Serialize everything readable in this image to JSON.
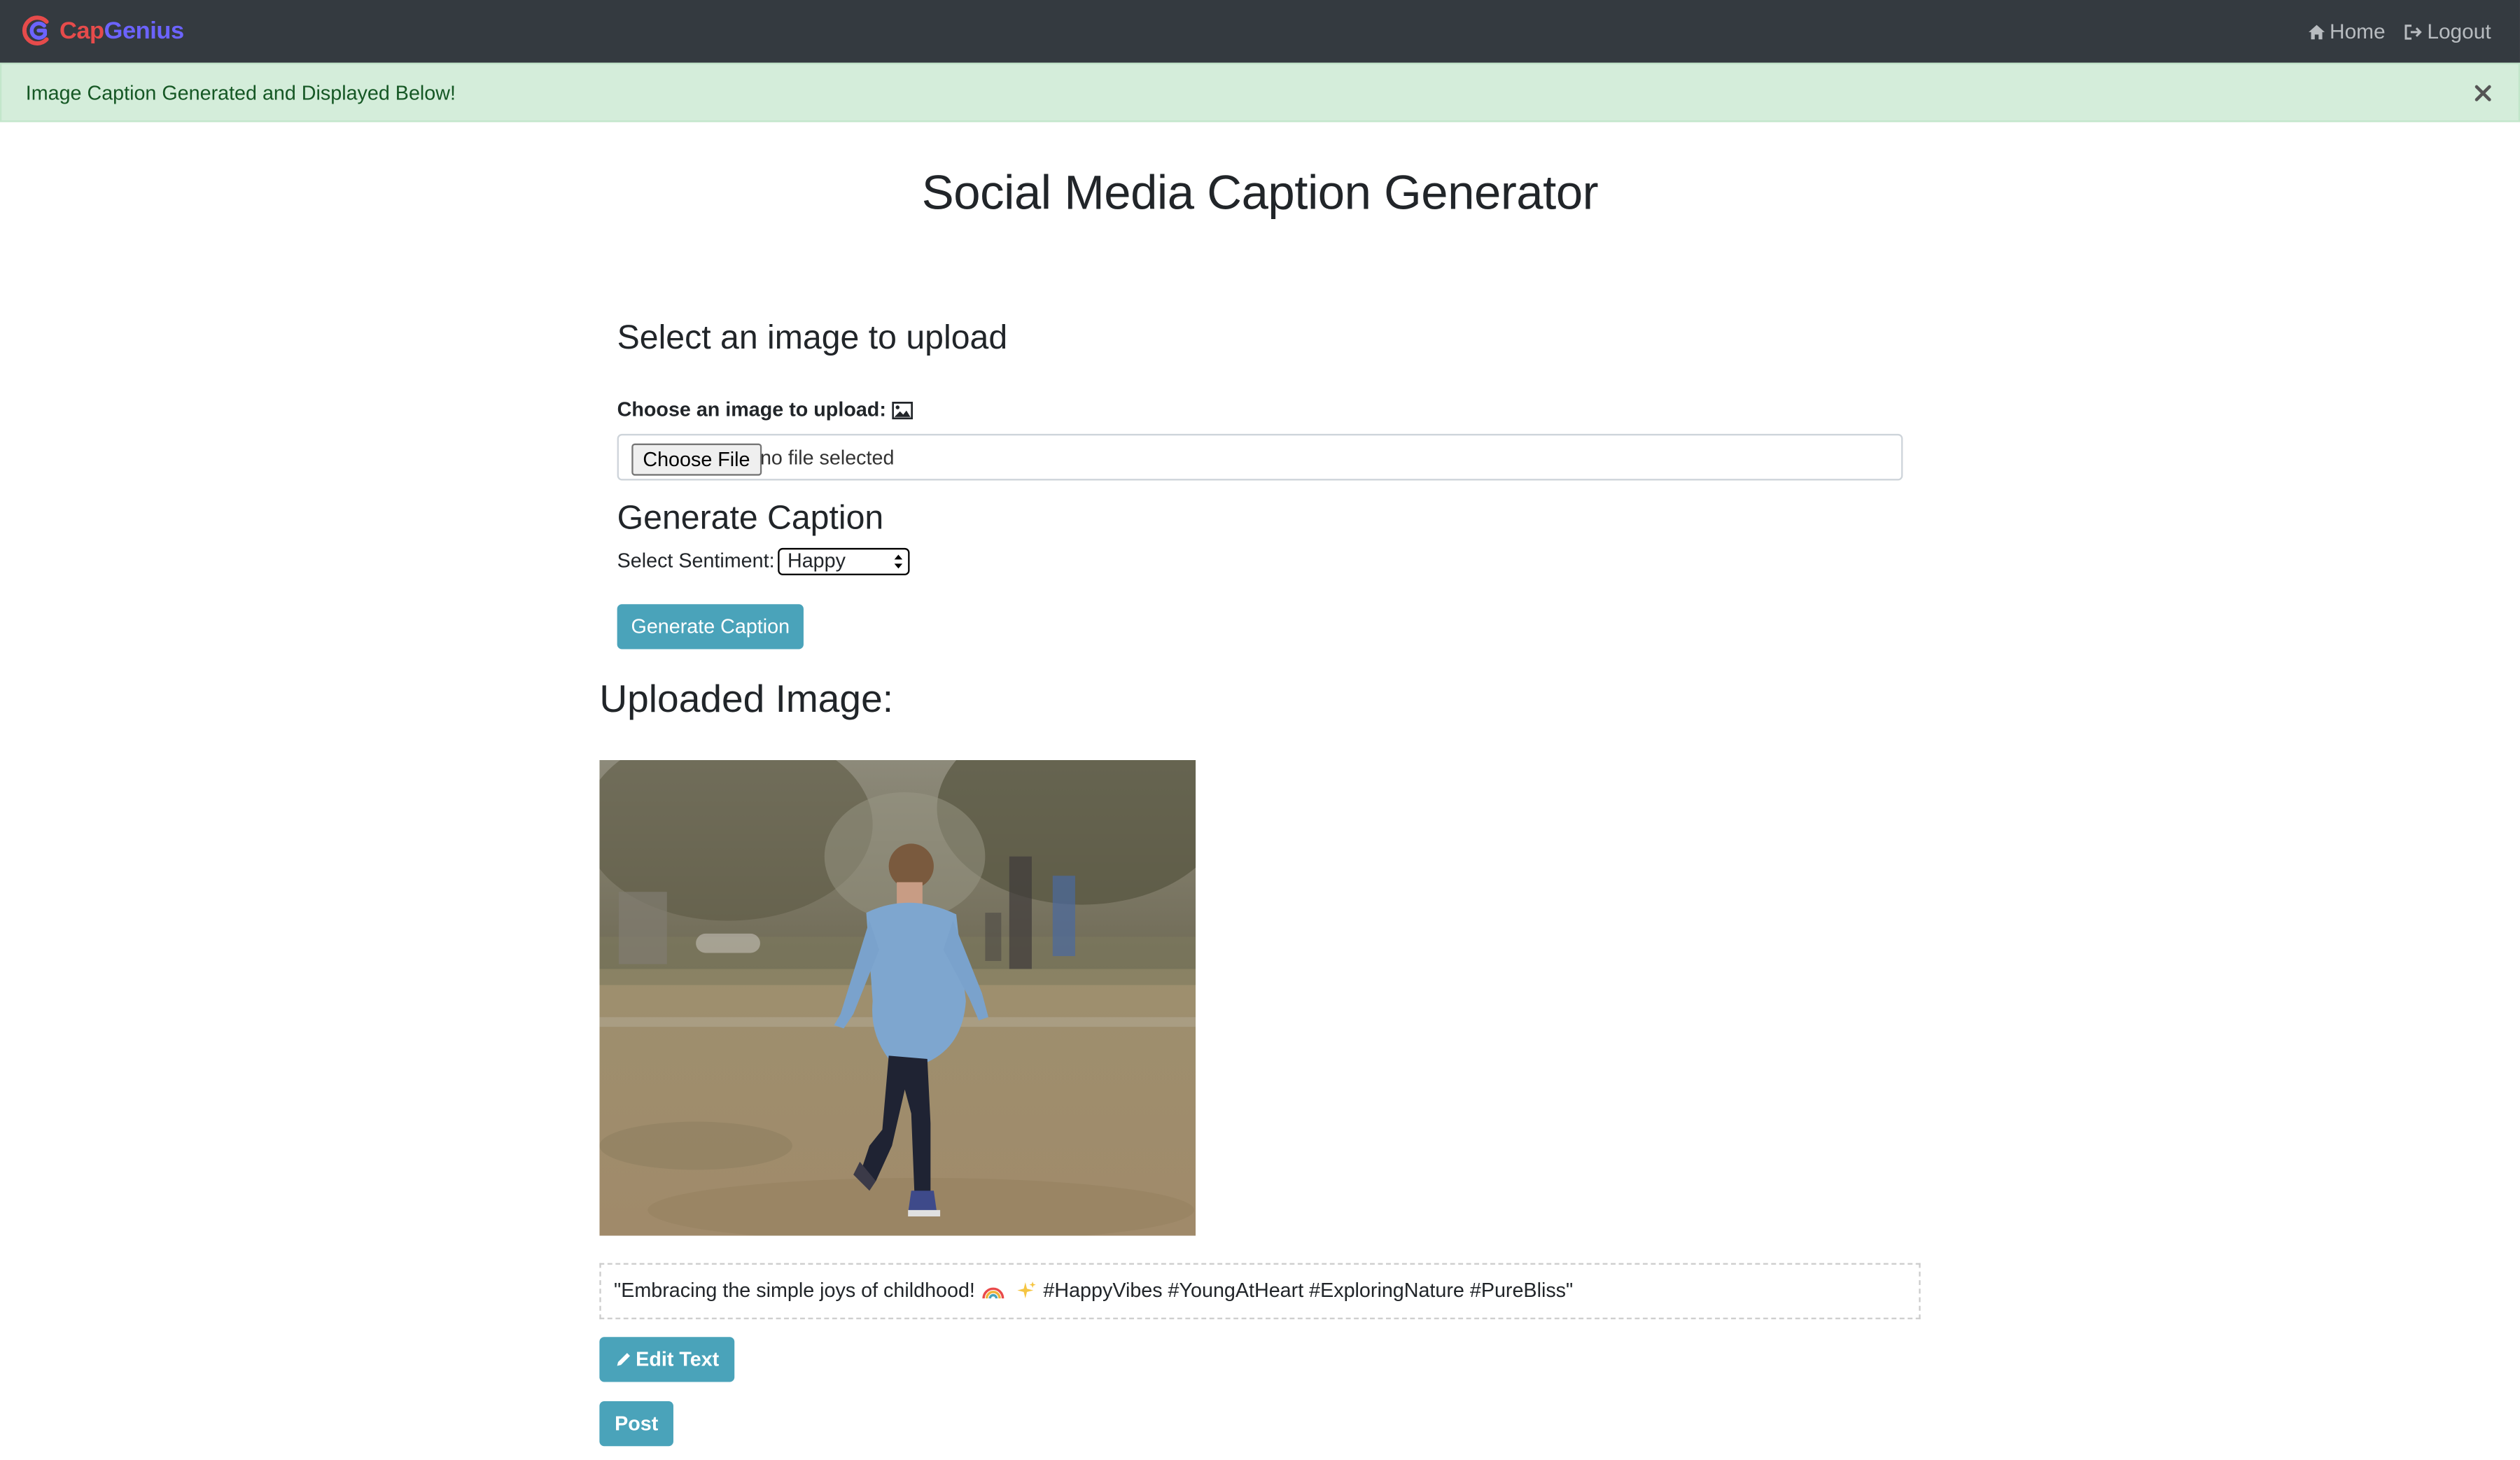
{
  "navbar": {
    "brand_cap": "Cap",
    "brand_genius": "Genius",
    "home_label": "Home",
    "logout_label": "Logout",
    "background_color": "#343a40"
  },
  "alert": {
    "message": "Image Caption Generated and Displayed Below!",
    "close_icon": "close-icon"
  },
  "page": {
    "title": "Social Media Caption Generator"
  },
  "upload": {
    "heading": "Select an image to upload",
    "label": "Choose an image to upload:",
    "label_icon": "image-icon",
    "choose_button": "Choose File",
    "file_status": "no file selected"
  },
  "generate": {
    "heading": "Generate Caption",
    "sentiment_label": "Select Sentiment:",
    "sentiment_value": "Happy",
    "button_label": "Generate Caption"
  },
  "result": {
    "heading": "Uploaded Image:",
    "caption_start": "\"Embracing the simple joys of childhood!",
    "caption_emojis": [
      "rainbow-emoji",
      "sparkles-emoji"
    ],
    "caption_tags": "#HappyVibes #YoungAtHeart #ExploringNature #PureBliss\"",
    "edit_button": "Edit Text",
    "post_button": "Post"
  },
  "colors": {
    "accent": "#4aa3ba",
    "alert_bg": "#d4edda",
    "alert_text": "#155724",
    "brand_red": "#e64b4b",
    "brand_purple": "#6c63ff"
  }
}
